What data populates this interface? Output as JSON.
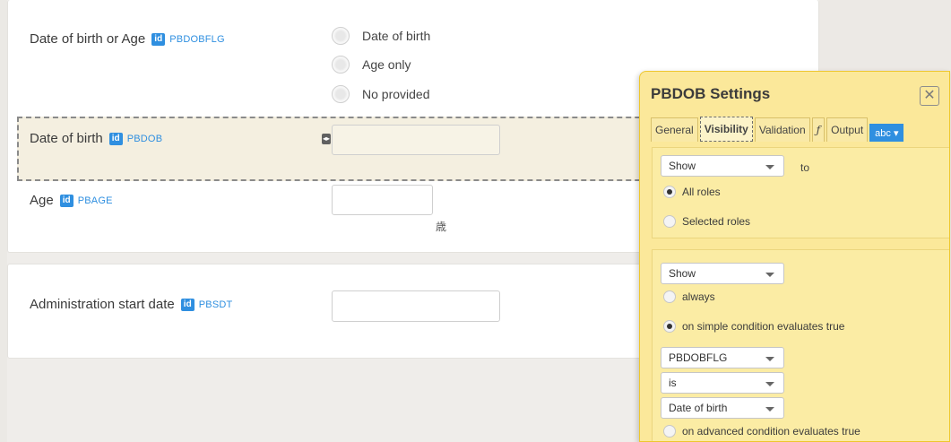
{
  "form": {
    "fields": [
      {
        "label": "Date of birth or Age",
        "id_badge": "id",
        "var": "PBDOBFLG"
      },
      {
        "label": "Date of birth",
        "id_badge": "id",
        "var": "PBDOB"
      },
      {
        "label": "Age",
        "id_badge": "id",
        "var": "PBAGE",
        "unit": "歳"
      },
      {
        "label": "Administration start date",
        "id_badge": "id",
        "var": "PBSDT"
      }
    ],
    "dob_flag_options": [
      "Date of birth",
      "Age only",
      "No provided"
    ]
  },
  "settings": {
    "title": "PBDOB Settings",
    "close_glyph": "✕",
    "tabs": [
      "General",
      "Visibility",
      "Validation",
      "ƒ",
      "Output",
      "abc ▾"
    ],
    "active_tab": "Visibility",
    "section1": {
      "select_value": "Show",
      "to_text": "to",
      "options": [
        {
          "label": "All roles",
          "checked": true
        },
        {
          "label": "Selected roles",
          "checked": false
        }
      ]
    },
    "section2": {
      "select_value": "Show",
      "options": [
        {
          "label": "always",
          "checked": false
        },
        {
          "label": "on simple condition evaluates true",
          "checked": true
        }
      ],
      "condition": {
        "variable": "PBDOBFLG",
        "operator": "is",
        "value": "Date of birth"
      },
      "advanced_option": {
        "label": "on advanced condition evaluates true",
        "checked": false
      }
    }
  },
  "colors": {
    "accent_blue": "#2f8fe0",
    "panel_yellow": "#fbe89a",
    "panel_border": "#eec72e"
  }
}
